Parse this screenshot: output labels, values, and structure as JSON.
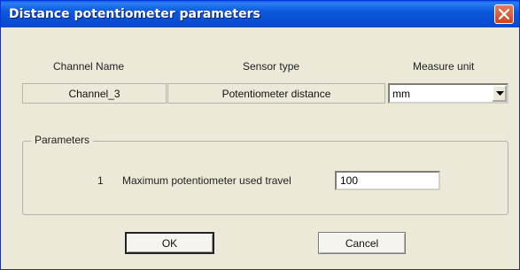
{
  "window": {
    "title": "Distance potentiometer parameters"
  },
  "columns": {
    "channel_name": "Channel Name",
    "sensor_type": "Sensor type",
    "measure_unit": "Measure unit"
  },
  "row": {
    "channel": "Channel_3",
    "sensor": "Potentiometer distance",
    "unit": "mm"
  },
  "parameters": {
    "group_label": "Parameters",
    "items": [
      {
        "index": "1",
        "label": "Maximum potentiometer used travel",
        "value": "100"
      }
    ]
  },
  "buttons": {
    "ok": "OK",
    "cancel": "Cancel"
  },
  "colors": {
    "titlebar": "#0b58df",
    "close": "#d1411e",
    "face": "#ece9d8"
  }
}
